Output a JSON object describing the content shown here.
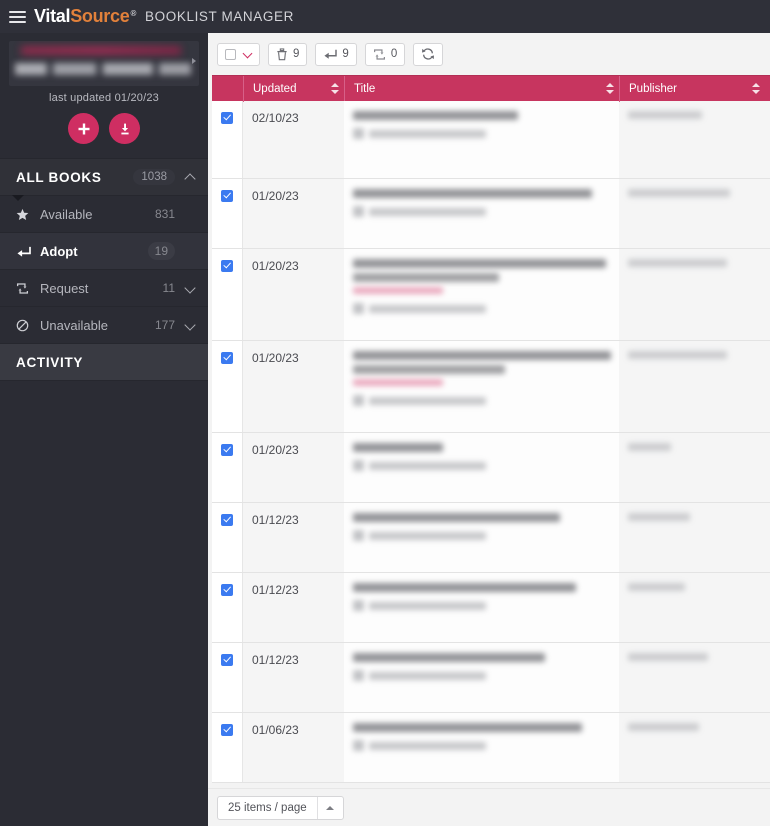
{
  "header": {
    "menu_icon": "hamburger-icon",
    "brand_part1": "Vital",
    "brand_part2": "Source",
    "brand_reg": "®",
    "app_title": "BOOKLIST MANAGER"
  },
  "sidebar": {
    "account_redacted": true,
    "last_updated": "last updated 01/20/23",
    "add_button_label": "+",
    "download_button_label": "download-icon",
    "section": {
      "label": "ALL BOOKS",
      "count": "1038",
      "expanded": true
    },
    "items": [
      {
        "label": "Available",
        "count": "831",
        "icon": "star-icon",
        "active": false,
        "has_chevron": false
      },
      {
        "label": "Adopt",
        "count": "19",
        "icon": "return-arrow-icon",
        "active": true,
        "has_chevron": false
      },
      {
        "label": "Request",
        "count": "11",
        "icon": "repeat-icon",
        "active": false,
        "has_chevron": true
      },
      {
        "label": "Unavailable",
        "count": "177",
        "icon": "blocked-icon",
        "active": false,
        "has_chevron": true
      }
    ],
    "activity_label": "ACTIVITY"
  },
  "toolbar": {
    "select_all": {
      "name": "select-all-dropdown",
      "checked": false,
      "chevron": "chevron-down-icon"
    },
    "buttons": [
      {
        "icon": "trash-icon",
        "count": "9",
        "name": "delete-button"
      },
      {
        "icon": "return-arrow-icon",
        "count": "9",
        "name": "adopt-button"
      },
      {
        "icon": "repeat-icon",
        "count": "0",
        "name": "request-button"
      },
      {
        "icon": "refresh-icon",
        "count": "",
        "name": "refresh-button"
      }
    ]
  },
  "table": {
    "columns": [
      {
        "key": "select",
        "label": "",
        "sortable": false
      },
      {
        "key": "updated",
        "label": "Updated",
        "sortable": true
      },
      {
        "key": "title",
        "label": "Title",
        "sortable": true
      },
      {
        "key": "publisher",
        "label": "Publisher",
        "sortable": true
      }
    ],
    "rows": [
      {
        "selected": true,
        "updated": "02/10/23",
        "title": "",
        "publisher": "",
        "redacted": true,
        "title_lines": 1,
        "has_link": false
      },
      {
        "selected": true,
        "updated": "01/20/23",
        "title": "",
        "publisher": "",
        "redacted": true,
        "title_lines": 1,
        "has_link": false
      },
      {
        "selected": true,
        "updated": "01/20/23",
        "title": "",
        "publisher": "",
        "redacted": true,
        "title_lines": 2,
        "has_link": true
      },
      {
        "selected": true,
        "updated": "01/20/23",
        "title": "",
        "publisher": "",
        "redacted": true,
        "title_lines": 2,
        "has_link": true
      },
      {
        "selected": true,
        "updated": "01/20/23",
        "title": "",
        "publisher": "",
        "redacted": true,
        "title_lines": 1,
        "has_link": false
      },
      {
        "selected": true,
        "updated": "01/12/23",
        "title": "",
        "publisher": "",
        "redacted": true,
        "title_lines": 1,
        "has_link": false
      },
      {
        "selected": true,
        "updated": "01/12/23",
        "title": "",
        "publisher": "",
        "redacted": true,
        "title_lines": 1,
        "has_link": false
      },
      {
        "selected": true,
        "updated": "01/12/23",
        "title": "",
        "publisher": "",
        "redacted": true,
        "title_lines": 1,
        "has_link": false
      },
      {
        "selected": true,
        "updated": "01/06/23",
        "title": "",
        "publisher": "",
        "redacted": true,
        "title_lines": 1,
        "has_link": false
      }
    ]
  },
  "footer": {
    "page_size_label": "25 items / page",
    "page_size_caret": "chevron-up-icon"
  },
  "colors": {
    "brand_orange": "#e2813b",
    "accent_pink": "#cf2e62",
    "table_header": "#c7355f",
    "topbar_dark": "#2f3039",
    "sidebar_dark": "#2b2c34",
    "checkbox_blue": "#3b7af0"
  }
}
